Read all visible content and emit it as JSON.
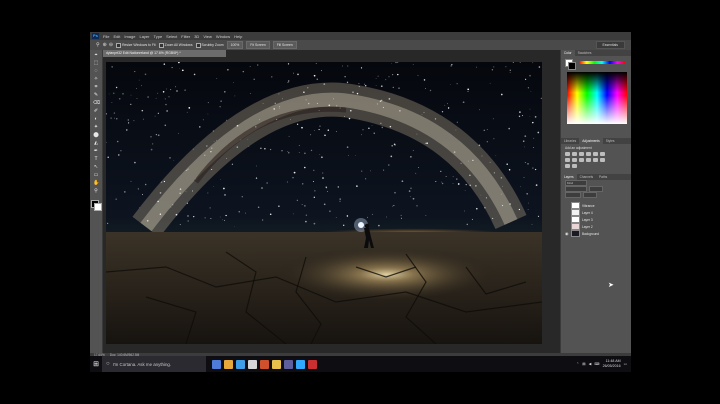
{
  "app": {
    "logo": "Ps",
    "menu": [
      "File",
      "Edit",
      "Image",
      "Layer",
      "Type",
      "Select",
      "Filter",
      "3D",
      "View",
      "Window",
      "Help"
    ],
    "options": {
      "buttons": [
        "Resize Windows to Fit",
        "Zoom All Windows",
        "Scrubby Zoom",
        "100%",
        "Fit Screen",
        "Fill Screen"
      ],
      "workspace": "Essentials"
    },
    "tools": [
      "⌖",
      "⬚",
      "◌",
      "✧",
      "⌗",
      "✎",
      "⌫",
      "✐",
      "◐",
      "✦",
      "⬤",
      "◭",
      "✒",
      "T",
      "↖",
      "▭",
      "✋",
      "⚲"
    ]
  },
  "document": {
    "tab_title": "dylanprt32 Edit Nationreland @ 17.6% (RGB/8*) *",
    "status": [
      "17.65%",
      "Doc: 140.6M/562.5M"
    ]
  },
  "floating_panel": {
    "items": [
      "History",
      "Actions",
      "Properties"
    ]
  },
  "panels": {
    "color_tabs": [
      "Color",
      "Swatches"
    ],
    "adjustment_tabs": [
      "Libraries",
      "Adjustments",
      "Styles"
    ],
    "adjustment_label": "Add an adjustment",
    "layers_tabs": [
      "Layers",
      "Channels",
      "Paths"
    ],
    "kind_label": "Kind",
    "layers": [
      {
        "name": "Vibrance",
        "visible": false,
        "thumb": "#ffffff"
      },
      {
        "name": "Layer 4",
        "visible": false,
        "thumb": "#f2f2f2"
      },
      {
        "name": "Layer 3",
        "visible": false,
        "thumb": "#ffffff"
      },
      {
        "name": "Layer 2",
        "visible": false,
        "thumb": "#e8d6d6"
      },
      {
        "name": "Background",
        "visible": true,
        "thumb": "#1c1a22"
      }
    ]
  },
  "taskbar": {
    "search_placeholder": "I'm Cortana. Ask me anything.",
    "time": "11:48 AM",
    "date": "26/05/2016",
    "icon_colors": [
      "#4e7bd9",
      "#e8a93a",
      "#3f9ee8",
      "#d6d6d6",
      "#d0502c",
      "#e8c14d",
      "#5e5e9e",
      "#31a8ff",
      "#cc2f2f"
    ]
  }
}
